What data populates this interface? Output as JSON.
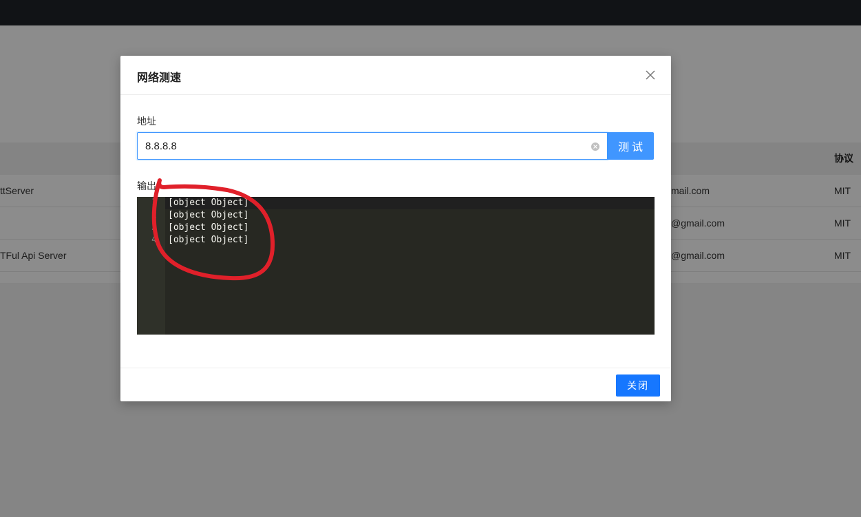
{
  "background": {
    "table_header": {
      "protocol": "协议"
    },
    "rows": [
      {
        "name": "ttServer",
        "email": "mail.com",
        "license": "MIT"
      },
      {
        "name": "",
        "email": "@gmail.com",
        "license": "MIT"
      },
      {
        "name": "TFul Api Server",
        "email": "@gmail.com",
        "license": "MIT"
      }
    ]
  },
  "modal": {
    "title": "网络测速",
    "address_label": "地址",
    "address_value": "8.8.8.8",
    "test_button": "测试",
    "output_label": "输出",
    "output_lines": [
      "[object Object]",
      "[object Object]",
      "[object Object]",
      "[object Object]"
    ],
    "line_numbers": [
      "1",
      "2",
      "3",
      "4"
    ],
    "close_button": "关闭"
  },
  "colors": {
    "primary": "#1677ff",
    "editor_bg": "#272822",
    "annotation_stroke": "#e0202a"
  }
}
